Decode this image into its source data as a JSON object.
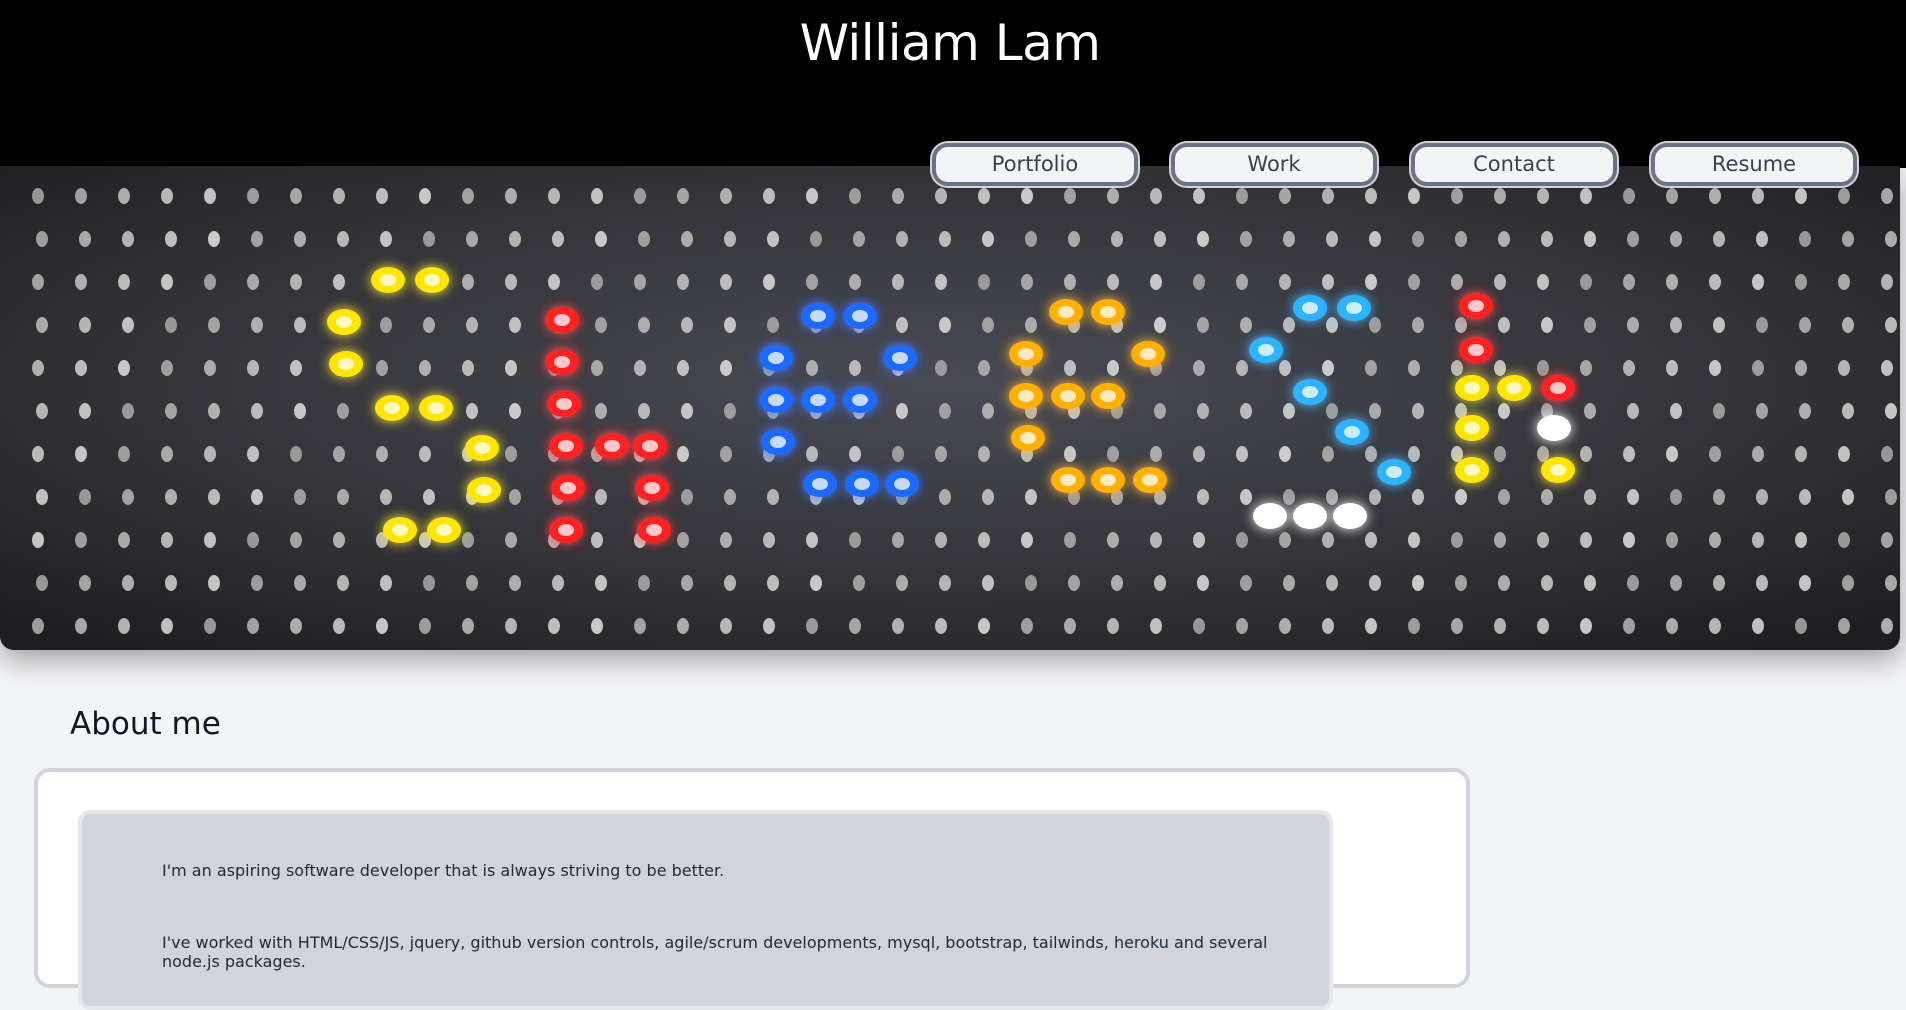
{
  "header": {
    "title": "William Lam"
  },
  "nav": {
    "items": [
      {
        "label": "Portfolio"
      },
      {
        "label": "Work"
      },
      {
        "label": "Contact"
      },
      {
        "label": "Resume"
      }
    ]
  },
  "hero": {
    "description": "",
    "led_colors": {
      "yellow": "#ffe600",
      "red": "#ff2020",
      "blue": "#1e6bff",
      "orange": "#ffb000",
      "cyan": "#2db4ff",
      "white": "#ffffff"
    }
  },
  "about": {
    "heading": "About me",
    "paragraphs": [
      "I'm an aspiring software developer that is always striving to be better.",
      "I've worked with HTML/CSS/JS, jquery, github version controls, agile/scrum developments, mysql, bootstrap, tailwinds, heroku and several node.js packages."
    ]
  },
  "colors": {
    "header_bg": "#000000",
    "page_bg": "#f3f4f6",
    "button_border": "#6b7280",
    "card_inner_bg": "#d1d5db"
  }
}
